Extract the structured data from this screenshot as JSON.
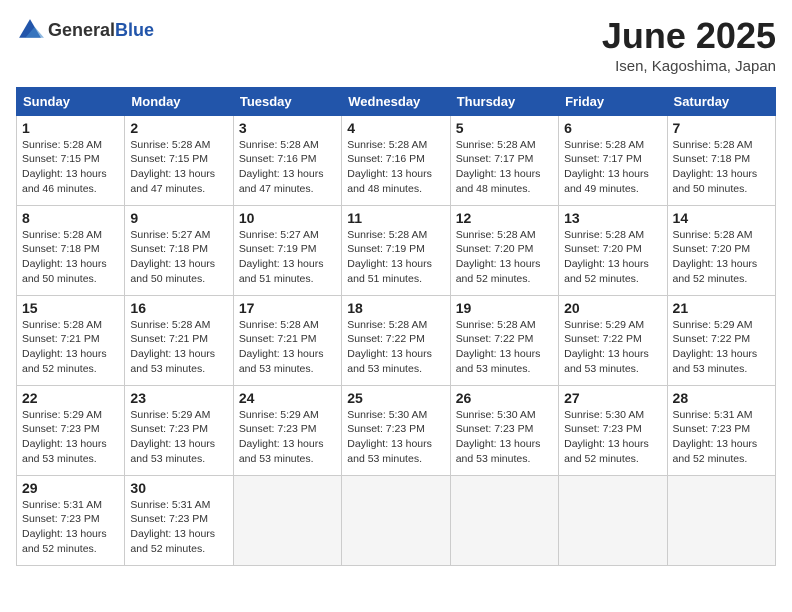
{
  "header": {
    "logo_general": "General",
    "logo_blue": "Blue",
    "month": "June 2025",
    "location": "Isen, Kagoshima, Japan"
  },
  "weekdays": [
    "Sunday",
    "Monday",
    "Tuesday",
    "Wednesday",
    "Thursday",
    "Friday",
    "Saturday"
  ],
  "weeks": [
    [
      {
        "day": "1",
        "sunrise": "Sunrise: 5:28 AM",
        "sunset": "Sunset: 7:15 PM",
        "daylight": "Daylight: 13 hours and 46 minutes."
      },
      {
        "day": "2",
        "sunrise": "Sunrise: 5:28 AM",
        "sunset": "Sunset: 7:15 PM",
        "daylight": "Daylight: 13 hours and 47 minutes."
      },
      {
        "day": "3",
        "sunrise": "Sunrise: 5:28 AM",
        "sunset": "Sunset: 7:16 PM",
        "daylight": "Daylight: 13 hours and 47 minutes."
      },
      {
        "day": "4",
        "sunrise": "Sunrise: 5:28 AM",
        "sunset": "Sunset: 7:16 PM",
        "daylight": "Daylight: 13 hours and 48 minutes."
      },
      {
        "day": "5",
        "sunrise": "Sunrise: 5:28 AM",
        "sunset": "Sunset: 7:17 PM",
        "daylight": "Daylight: 13 hours and 48 minutes."
      },
      {
        "day": "6",
        "sunrise": "Sunrise: 5:28 AM",
        "sunset": "Sunset: 7:17 PM",
        "daylight": "Daylight: 13 hours and 49 minutes."
      },
      {
        "day": "7",
        "sunrise": "Sunrise: 5:28 AM",
        "sunset": "Sunset: 7:18 PM",
        "daylight": "Daylight: 13 hours and 50 minutes."
      }
    ],
    [
      {
        "day": "8",
        "sunrise": "Sunrise: 5:28 AM",
        "sunset": "Sunset: 7:18 PM",
        "daylight": "Daylight: 13 hours and 50 minutes."
      },
      {
        "day": "9",
        "sunrise": "Sunrise: 5:27 AM",
        "sunset": "Sunset: 7:18 PM",
        "daylight": "Daylight: 13 hours and 50 minutes."
      },
      {
        "day": "10",
        "sunrise": "Sunrise: 5:27 AM",
        "sunset": "Sunset: 7:19 PM",
        "daylight": "Daylight: 13 hours and 51 minutes."
      },
      {
        "day": "11",
        "sunrise": "Sunrise: 5:28 AM",
        "sunset": "Sunset: 7:19 PM",
        "daylight": "Daylight: 13 hours and 51 minutes."
      },
      {
        "day": "12",
        "sunrise": "Sunrise: 5:28 AM",
        "sunset": "Sunset: 7:20 PM",
        "daylight": "Daylight: 13 hours and 52 minutes."
      },
      {
        "day": "13",
        "sunrise": "Sunrise: 5:28 AM",
        "sunset": "Sunset: 7:20 PM",
        "daylight": "Daylight: 13 hours and 52 minutes."
      },
      {
        "day": "14",
        "sunrise": "Sunrise: 5:28 AM",
        "sunset": "Sunset: 7:20 PM",
        "daylight": "Daylight: 13 hours and 52 minutes."
      }
    ],
    [
      {
        "day": "15",
        "sunrise": "Sunrise: 5:28 AM",
        "sunset": "Sunset: 7:21 PM",
        "daylight": "Daylight: 13 hours and 52 minutes."
      },
      {
        "day": "16",
        "sunrise": "Sunrise: 5:28 AM",
        "sunset": "Sunset: 7:21 PM",
        "daylight": "Daylight: 13 hours and 53 minutes."
      },
      {
        "day": "17",
        "sunrise": "Sunrise: 5:28 AM",
        "sunset": "Sunset: 7:21 PM",
        "daylight": "Daylight: 13 hours and 53 minutes."
      },
      {
        "day": "18",
        "sunrise": "Sunrise: 5:28 AM",
        "sunset": "Sunset: 7:22 PM",
        "daylight": "Daylight: 13 hours and 53 minutes."
      },
      {
        "day": "19",
        "sunrise": "Sunrise: 5:28 AM",
        "sunset": "Sunset: 7:22 PM",
        "daylight": "Daylight: 13 hours and 53 minutes."
      },
      {
        "day": "20",
        "sunrise": "Sunrise: 5:29 AM",
        "sunset": "Sunset: 7:22 PM",
        "daylight": "Daylight: 13 hours and 53 minutes."
      },
      {
        "day": "21",
        "sunrise": "Sunrise: 5:29 AM",
        "sunset": "Sunset: 7:22 PM",
        "daylight": "Daylight: 13 hours and 53 minutes."
      }
    ],
    [
      {
        "day": "22",
        "sunrise": "Sunrise: 5:29 AM",
        "sunset": "Sunset: 7:23 PM",
        "daylight": "Daylight: 13 hours and 53 minutes."
      },
      {
        "day": "23",
        "sunrise": "Sunrise: 5:29 AM",
        "sunset": "Sunset: 7:23 PM",
        "daylight": "Daylight: 13 hours and 53 minutes."
      },
      {
        "day": "24",
        "sunrise": "Sunrise: 5:29 AM",
        "sunset": "Sunset: 7:23 PM",
        "daylight": "Daylight: 13 hours and 53 minutes."
      },
      {
        "day": "25",
        "sunrise": "Sunrise: 5:30 AM",
        "sunset": "Sunset: 7:23 PM",
        "daylight": "Daylight: 13 hours and 53 minutes."
      },
      {
        "day": "26",
        "sunrise": "Sunrise: 5:30 AM",
        "sunset": "Sunset: 7:23 PM",
        "daylight": "Daylight: 13 hours and 53 minutes."
      },
      {
        "day": "27",
        "sunrise": "Sunrise: 5:30 AM",
        "sunset": "Sunset: 7:23 PM",
        "daylight": "Daylight: 13 hours and 52 minutes."
      },
      {
        "day": "28",
        "sunrise": "Sunrise: 5:31 AM",
        "sunset": "Sunset: 7:23 PM",
        "daylight": "Daylight: 13 hours and 52 minutes."
      }
    ],
    [
      {
        "day": "29",
        "sunrise": "Sunrise: 5:31 AM",
        "sunset": "Sunset: 7:23 PM",
        "daylight": "Daylight: 13 hours and 52 minutes."
      },
      {
        "day": "30",
        "sunrise": "Sunrise: 5:31 AM",
        "sunset": "Sunset: 7:23 PM",
        "daylight": "Daylight: 13 hours and 52 minutes."
      },
      null,
      null,
      null,
      null,
      null
    ]
  ]
}
